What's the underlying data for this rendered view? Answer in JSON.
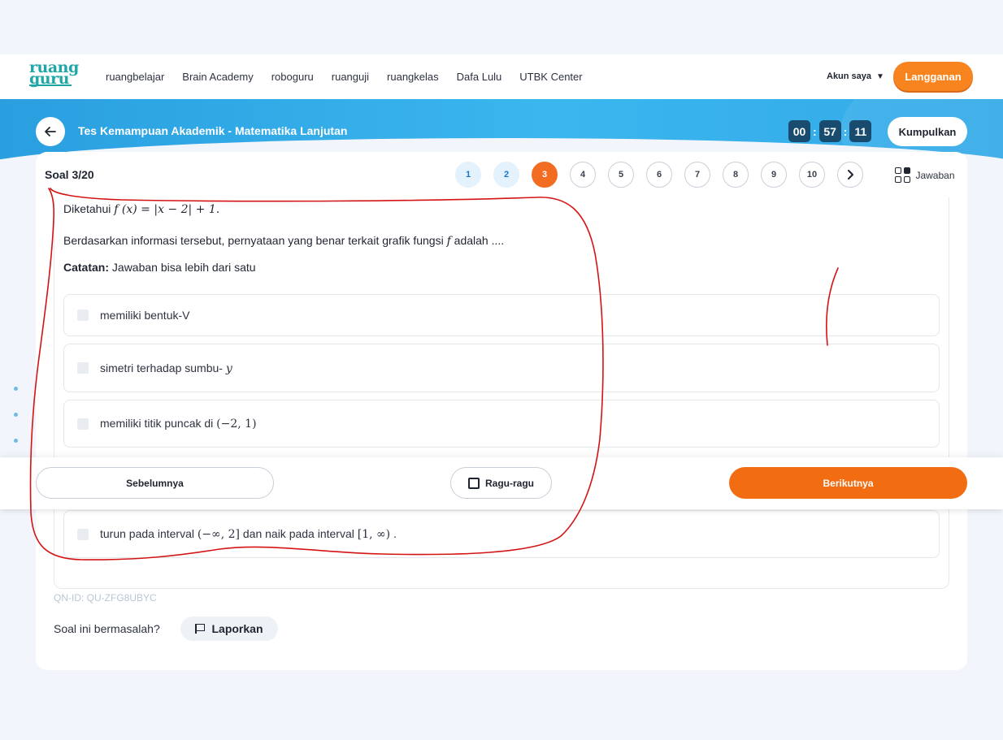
{
  "nav": {
    "logo_line1": "ruang",
    "logo_line2": "guru",
    "links": [
      "ruangbelajar",
      "Brain Academy",
      "roboguru",
      "ruanguji",
      "ruangkelas",
      "Dafa Lulu",
      "UTBK Center"
    ],
    "account": "Akun saya",
    "subscribe": "Langganan"
  },
  "header": {
    "title": "Tes Kemampuan Akademik - Matematika Lanjutan",
    "timer": {
      "hours": "00",
      "minutes": "57",
      "seconds": "11"
    },
    "submit": "Kumpulkan"
  },
  "question": {
    "counter": "Soal 3/20",
    "numbers": [
      "1",
      "2",
      "3",
      "4",
      "5",
      "6",
      "7",
      "8",
      "9",
      "10"
    ],
    "answered": [
      "1",
      "2"
    ],
    "current": "3",
    "answers_button": "Jawaban",
    "intro_prefix": "Diketahui ",
    "intro_math": "f (x) = |x − 2| + 1.",
    "statement_prefix": "Berdasarkan informasi tersebut, pernyataan yang benar terkait grafik fungsi ",
    "statement_math": "f",
    "statement_suffix": " adalah ....",
    "note_label": "Catatan:",
    "note_text": " Jawaban bisa lebih dari satu",
    "options": [
      {
        "prefix": "memiliki bentuk-V",
        "math": "",
        "suffix": ""
      },
      {
        "prefix": "simetri terhadap sumbu- ",
        "math": "y",
        "suffix": ""
      },
      {
        "prefix": "memiliki titik puncak di ",
        "math": "(−2,  1)",
        "suffix": ""
      },
      {
        "prefix": "turun pada interval ",
        "math": "(−∞, 2]",
        "middle": " dan naik pada interval ",
        "math2": "[1, ∞)",
        "suffix": " ."
      }
    ]
  },
  "footer": {
    "prev": "Sebelumnya",
    "doubt": "Ragu-ragu",
    "next": "Berikutnya",
    "qn_id": "QN-ID: QU-ZFG8UBYC",
    "report_question": "Soal ini bermasalah?",
    "report_button": "Laporkan"
  },
  "colors": {
    "accent_orange": "#f26d12",
    "banner_blue": "#2a9fe0",
    "timer_box": "#194b6e",
    "annotation_red": "#d41414"
  }
}
